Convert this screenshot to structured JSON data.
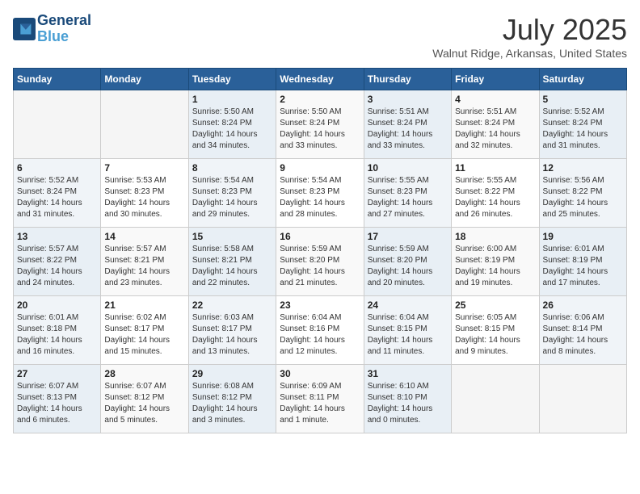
{
  "header": {
    "logo_line1": "General",
    "logo_line2": "Blue",
    "month_year": "July 2025",
    "location": "Walnut Ridge, Arkansas, United States"
  },
  "weekdays": [
    "Sunday",
    "Monday",
    "Tuesday",
    "Wednesday",
    "Thursday",
    "Friday",
    "Saturday"
  ],
  "weeks": [
    [
      {
        "day": "",
        "info": ""
      },
      {
        "day": "",
        "info": ""
      },
      {
        "day": "1",
        "info": "Sunrise: 5:50 AM\nSunset: 8:24 PM\nDaylight: 14 hours and 34 minutes."
      },
      {
        "day": "2",
        "info": "Sunrise: 5:50 AM\nSunset: 8:24 PM\nDaylight: 14 hours and 33 minutes."
      },
      {
        "day": "3",
        "info": "Sunrise: 5:51 AM\nSunset: 8:24 PM\nDaylight: 14 hours and 33 minutes."
      },
      {
        "day": "4",
        "info": "Sunrise: 5:51 AM\nSunset: 8:24 PM\nDaylight: 14 hours and 32 minutes."
      },
      {
        "day": "5",
        "info": "Sunrise: 5:52 AM\nSunset: 8:24 PM\nDaylight: 14 hours and 31 minutes."
      }
    ],
    [
      {
        "day": "6",
        "info": "Sunrise: 5:52 AM\nSunset: 8:24 PM\nDaylight: 14 hours and 31 minutes."
      },
      {
        "day": "7",
        "info": "Sunrise: 5:53 AM\nSunset: 8:23 PM\nDaylight: 14 hours and 30 minutes."
      },
      {
        "day": "8",
        "info": "Sunrise: 5:54 AM\nSunset: 8:23 PM\nDaylight: 14 hours and 29 minutes."
      },
      {
        "day": "9",
        "info": "Sunrise: 5:54 AM\nSunset: 8:23 PM\nDaylight: 14 hours and 28 minutes."
      },
      {
        "day": "10",
        "info": "Sunrise: 5:55 AM\nSunset: 8:23 PM\nDaylight: 14 hours and 27 minutes."
      },
      {
        "day": "11",
        "info": "Sunrise: 5:55 AM\nSunset: 8:22 PM\nDaylight: 14 hours and 26 minutes."
      },
      {
        "day": "12",
        "info": "Sunrise: 5:56 AM\nSunset: 8:22 PM\nDaylight: 14 hours and 25 minutes."
      }
    ],
    [
      {
        "day": "13",
        "info": "Sunrise: 5:57 AM\nSunset: 8:22 PM\nDaylight: 14 hours and 24 minutes."
      },
      {
        "day": "14",
        "info": "Sunrise: 5:57 AM\nSunset: 8:21 PM\nDaylight: 14 hours and 23 minutes."
      },
      {
        "day": "15",
        "info": "Sunrise: 5:58 AM\nSunset: 8:21 PM\nDaylight: 14 hours and 22 minutes."
      },
      {
        "day": "16",
        "info": "Sunrise: 5:59 AM\nSunset: 8:20 PM\nDaylight: 14 hours and 21 minutes."
      },
      {
        "day": "17",
        "info": "Sunrise: 5:59 AM\nSunset: 8:20 PM\nDaylight: 14 hours and 20 minutes."
      },
      {
        "day": "18",
        "info": "Sunrise: 6:00 AM\nSunset: 8:19 PM\nDaylight: 14 hours and 19 minutes."
      },
      {
        "day": "19",
        "info": "Sunrise: 6:01 AM\nSunset: 8:19 PM\nDaylight: 14 hours and 17 minutes."
      }
    ],
    [
      {
        "day": "20",
        "info": "Sunrise: 6:01 AM\nSunset: 8:18 PM\nDaylight: 14 hours and 16 minutes."
      },
      {
        "day": "21",
        "info": "Sunrise: 6:02 AM\nSunset: 8:17 PM\nDaylight: 14 hours and 15 minutes."
      },
      {
        "day": "22",
        "info": "Sunrise: 6:03 AM\nSunset: 8:17 PM\nDaylight: 14 hours and 13 minutes."
      },
      {
        "day": "23",
        "info": "Sunrise: 6:04 AM\nSunset: 8:16 PM\nDaylight: 14 hours and 12 minutes."
      },
      {
        "day": "24",
        "info": "Sunrise: 6:04 AM\nSunset: 8:15 PM\nDaylight: 14 hours and 11 minutes."
      },
      {
        "day": "25",
        "info": "Sunrise: 6:05 AM\nSunset: 8:15 PM\nDaylight: 14 hours and 9 minutes."
      },
      {
        "day": "26",
        "info": "Sunrise: 6:06 AM\nSunset: 8:14 PM\nDaylight: 14 hours and 8 minutes."
      }
    ],
    [
      {
        "day": "27",
        "info": "Sunrise: 6:07 AM\nSunset: 8:13 PM\nDaylight: 14 hours and 6 minutes."
      },
      {
        "day": "28",
        "info": "Sunrise: 6:07 AM\nSunset: 8:12 PM\nDaylight: 14 hours and 5 minutes."
      },
      {
        "day": "29",
        "info": "Sunrise: 6:08 AM\nSunset: 8:12 PM\nDaylight: 14 hours and 3 minutes."
      },
      {
        "day": "30",
        "info": "Sunrise: 6:09 AM\nSunset: 8:11 PM\nDaylight: 14 hours and 1 minute."
      },
      {
        "day": "31",
        "info": "Sunrise: 6:10 AM\nSunset: 8:10 PM\nDaylight: 14 hours and 0 minutes."
      },
      {
        "day": "",
        "info": ""
      },
      {
        "day": "",
        "info": ""
      }
    ]
  ]
}
